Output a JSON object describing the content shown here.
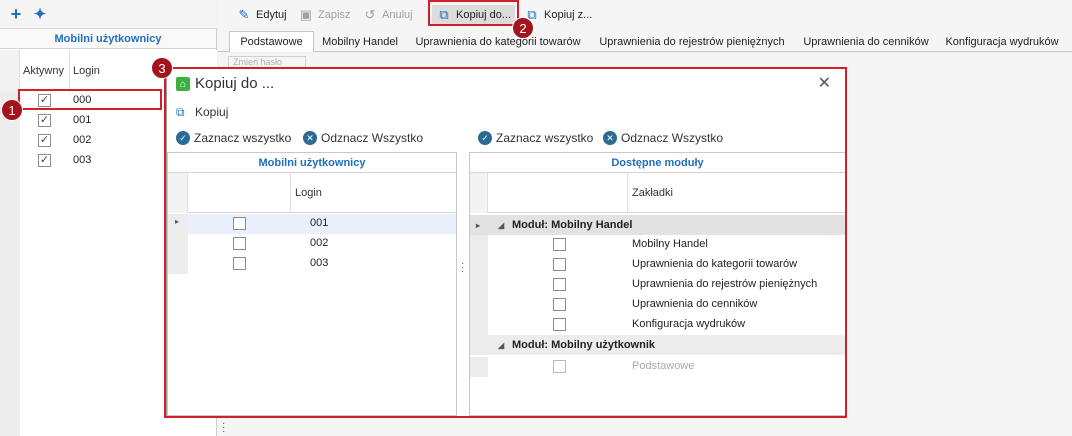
{
  "left_toolbar": {
    "add_icon": "plus-icon",
    "wand_icon": "magic-wand-icon"
  },
  "left_panel": {
    "title": "Mobilni użytkownicy",
    "columns": {
      "active": "Aktywny",
      "login": "Login"
    },
    "rows": [
      {
        "login": "000",
        "checked": true
      },
      {
        "login": "001",
        "checked": true
      },
      {
        "login": "002",
        "checked": true
      },
      {
        "login": "003",
        "checked": true
      }
    ]
  },
  "toolbar": {
    "edit": "Edytuj",
    "save": "Zapisz",
    "cancel": "Anuluj",
    "copy_to": "Kopiuj do...",
    "copy_from": "Kopiuj z..."
  },
  "tabs": [
    "Podstawowe",
    "Mobilny Handel",
    "Uprawnienia do kategorii towarów",
    "Uprawnienia do rejestrów pieniężnych",
    "Uprawnienia do cenników",
    "Konfiguracja wydruków"
  ],
  "main": {
    "change_password": "Zmień hasło"
  },
  "dialog": {
    "title": "Kopiuj do ...",
    "copy_button": "Kopiuj",
    "select_all": "Zaznacz wszystko",
    "deselect_all": "Odznacz Wszystko",
    "users_grid": {
      "title": "Mobilni użytkownicy",
      "login_col": "Login",
      "rows": [
        "001",
        "002",
        "003"
      ]
    },
    "modules_grid": {
      "title": "Dostępne moduły",
      "tabs_col": "Zakładki",
      "groups": [
        {
          "name": "Moduł: Mobilny Handel",
          "items": [
            "Mobilny Handel",
            "Uprawnienia do kategorii towarów",
            "Uprawnienia do rejestrów pieniężnych",
            "Uprawnienia do cenników",
            "Konfiguracja wydruków"
          ]
        },
        {
          "name": "Moduł: Mobilny użytkownik",
          "items": [
            "Podstawowe"
          ]
        }
      ]
    }
  },
  "callouts": {
    "one": "1",
    "two": "2",
    "three": "3"
  },
  "colors": {
    "accent": "#1e6fbf",
    "highlight": "#d0212b",
    "badge": "#a3141c"
  }
}
